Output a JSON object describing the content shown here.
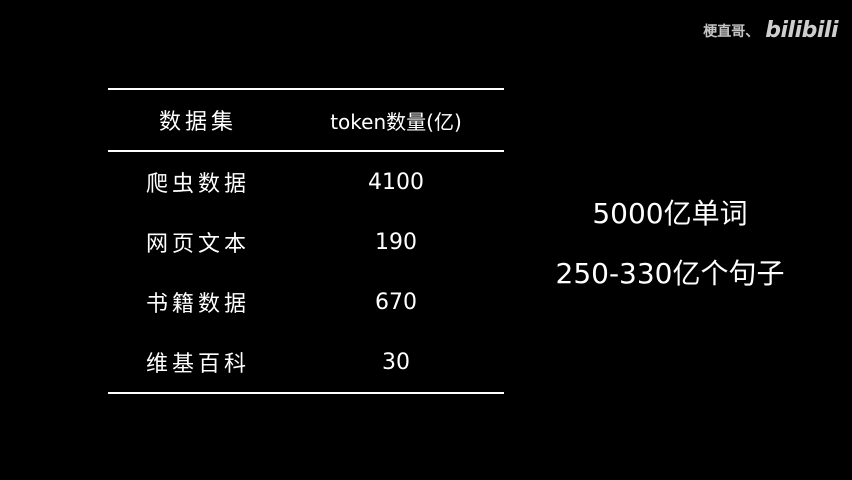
{
  "watermark": {
    "author": "梗直哥、",
    "logo": "bilibili"
  },
  "table": {
    "headers": [
      "数据集",
      "token数量(亿)"
    ],
    "rows": [
      {
        "name": "爬虫数据",
        "value": "4100"
      },
      {
        "name": "网页文本",
        "value": "190"
      },
      {
        "name": "书籍数据",
        "value": "670"
      },
      {
        "name": "维基百科",
        "value": "30"
      }
    ]
  },
  "stats": {
    "line1": "5000亿单词",
    "line2": "250-330亿个句子"
  }
}
